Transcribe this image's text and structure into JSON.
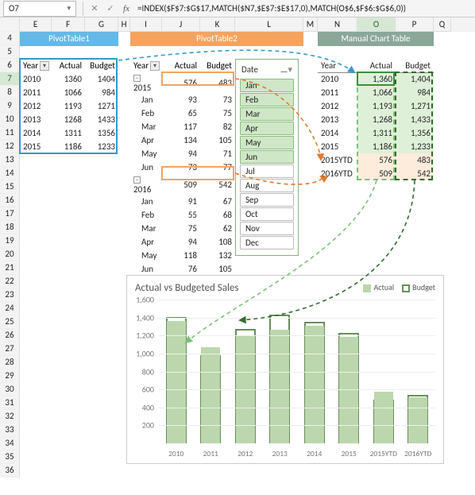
{
  "cell_ref": "O7",
  "formula": "=INDEX($F$7:$G$17,MATCH($N7,$E$7:$E$17,0),MATCH(O$6,$F$6:$G$6,0))",
  "cols": [
    {
      "letter": "E",
      "w": 40
    },
    {
      "letter": "F",
      "w": 42
    },
    {
      "letter": "G",
      "w": 42
    },
    {
      "letter": "H",
      "w": 15
    },
    {
      "letter": "I",
      "w": 40
    },
    {
      "letter": "J",
      "w": 48
    },
    {
      "letter": "K",
      "w": 44
    },
    {
      "letter": "L",
      "w": 86
    },
    {
      "letter": "M",
      "w": 18
    },
    {
      "letter": "N",
      "w": 50
    },
    {
      "letter": "O",
      "w": 48
    },
    {
      "letter": "P",
      "w": 48
    },
    {
      "letter": "Q",
      "w": 22
    }
  ],
  "rows_start": 4,
  "rows_end": 36,
  "selected_col": "O",
  "selected_row": 7,
  "banners": {
    "pt1": "PivotTable1",
    "pt2": "PivotTable2",
    "mct": "Manual Chart Table"
  },
  "pt1": {
    "headers": [
      "Year",
      "Actual",
      "Budget"
    ],
    "rows": [
      [
        "2010",
        1360,
        1404
      ],
      [
        "2011",
        1066,
        984
      ],
      [
        "2012",
        1193,
        1271
      ],
      [
        "2013",
        1268,
        1433
      ],
      [
        "2014",
        1311,
        1356
      ],
      [
        "2015",
        1186,
        1233
      ]
    ]
  },
  "pt2": {
    "headers": [
      "Year",
      "Actual",
      "Budget"
    ],
    "rows": [
      {
        "y": "2015",
        "a": 576,
        "b": 483,
        "group": true
      },
      {
        "y": "Jan",
        "a": 93,
        "b": 73
      },
      {
        "y": "Feb",
        "a": 65,
        "b": 75
      },
      {
        "y": "Mar",
        "a": 117,
        "b": 82
      },
      {
        "y": "Apr",
        "a": 134,
        "b": 105
      },
      {
        "y": "May",
        "a": 94,
        "b": 71
      },
      {
        "y": "Jun",
        "a": 73,
        "b": 77
      },
      {
        "y": "2016",
        "a": 509,
        "b": 542,
        "group": true
      },
      {
        "y": "Jan",
        "a": 91,
        "b": 67
      },
      {
        "y": "Feb",
        "a": 55,
        "b": 68
      },
      {
        "y": "Mar",
        "a": 75,
        "b": 62
      },
      {
        "y": "Apr",
        "a": 94,
        "b": 108
      },
      {
        "y": "May",
        "a": 118,
        "b": 132
      },
      {
        "y": "Jun",
        "a": 76,
        "b": 105
      }
    ]
  },
  "slicer": {
    "title": "Date",
    "items": [
      {
        "label": "Jan",
        "on": true
      },
      {
        "label": "Feb",
        "on": true
      },
      {
        "label": "Mar",
        "on": true
      },
      {
        "label": "Apr",
        "on": true
      },
      {
        "label": "May",
        "on": true
      },
      {
        "label": "Jun",
        "on": true
      },
      {
        "label": "Jul",
        "on": false
      },
      {
        "label": "Aug",
        "on": false
      },
      {
        "label": "Sep",
        "on": false
      },
      {
        "label": "Oct",
        "on": false
      },
      {
        "label": "Nov",
        "on": false
      },
      {
        "label": "Dec",
        "on": false
      }
    ]
  },
  "mct": {
    "headers": [
      "Year",
      "Actual",
      "Budget"
    ],
    "rows": [
      {
        "y": "2010",
        "a": "1,360",
        "b": "1,404"
      },
      {
        "y": "2011",
        "a": "1,066",
        "b": "984"
      },
      {
        "y": "2012",
        "a": "1,193",
        "b": "1,271"
      },
      {
        "y": "2013",
        "a": "1,268",
        "b": "1,433"
      },
      {
        "y": "2014",
        "a": "1,311",
        "b": "1,356"
      },
      {
        "y": "2015",
        "a": "1,186",
        "b": "1,233"
      },
      {
        "y": "2015YTD",
        "a": "576",
        "b": "483"
      },
      {
        "y": "2016YTD",
        "a": "509",
        "b": "542"
      }
    ]
  },
  "chart": {
    "title": "Actual vs Budgeted Sales",
    "legend": {
      "actual": "Actual",
      "budget": "Budget"
    },
    "yticks": [
      200,
      400,
      600,
      800,
      1000,
      1200,
      1400,
      1600
    ],
    "ticklabels": [
      "200",
      "400",
      "600",
      "800",
      "1,000",
      "1,200",
      "1,400",
      "1,600"
    ]
  },
  "chart_data": {
    "type": "bar",
    "categories": [
      "2010",
      "2011",
      "2012",
      "2013",
      "2014",
      "2015",
      "2015YTD",
      "2016YTD"
    ],
    "series": [
      {
        "name": "Actual",
        "values": [
          1360,
          1066,
          1193,
          1268,
          1311,
          1186,
          576,
          509
        ]
      },
      {
        "name": "Budget",
        "values": [
          1404,
          984,
          1271,
          1433,
          1356,
          1233,
          483,
          542
        ]
      }
    ],
    "title": "Actual vs Budgeted Sales",
    "xlabel": "",
    "ylabel": "",
    "ylim": [
      0,
      1600
    ]
  }
}
